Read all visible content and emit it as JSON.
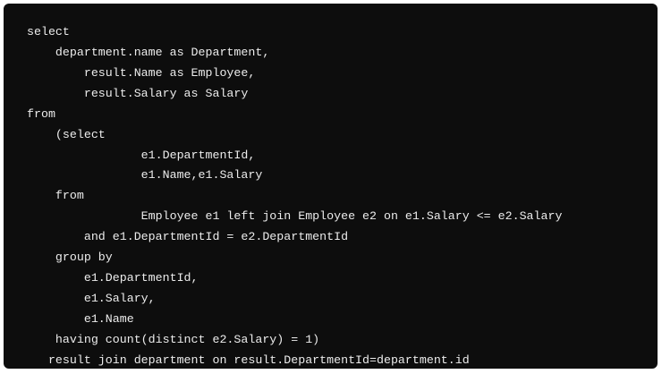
{
  "code_block": {
    "lines": [
      "select",
      "    department.name as Department,",
      "        result.Name as Employee,",
      "        result.Salary as Salary",
      "from",
      "    (select",
      "                e1.DepartmentId,",
      "                e1.Name,e1.Salary",
      "    from",
      "                Employee e1 left join Employee e2 on e1.Salary <= e2.Salary",
      "        and e1.DepartmentId = e2.DepartmentId",
      "    group by",
      "        e1.DepartmentId,",
      "        e1.Salary,",
      "        e1.Name",
      "    having count(distinct e2.Salary) = 1)",
      "   result join department on result.DepartmentId=department.id"
    ]
  }
}
